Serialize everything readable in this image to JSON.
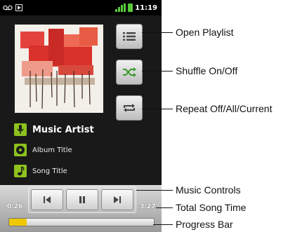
{
  "status_bar": {
    "left_icons": [
      "voicemail-icon",
      "media-play-icon"
    ],
    "time": "11:19"
  },
  "player": {
    "artist": "Music Artist",
    "album": "Album Title",
    "song": "Song Title",
    "elapsed": "0:26",
    "total": "3:27",
    "progress_fraction": 0.12
  },
  "side_buttons": [
    {
      "name": "open-playlist-button",
      "icon": "playlist-icon"
    },
    {
      "name": "shuffle-button",
      "icon": "shuffle-icon"
    },
    {
      "name": "repeat-button",
      "icon": "repeat-icon"
    }
  ],
  "controls": [
    {
      "name": "previous-button",
      "icon": "previous-icon"
    },
    {
      "name": "pause-button",
      "icon": "pause-icon"
    },
    {
      "name": "next-button",
      "icon": "next-icon"
    }
  ],
  "callouts": {
    "open_playlist": "Open Playlist",
    "shuffle": "Shuffle On/Off",
    "repeat": "Repeat Off/All/Current",
    "music_controls": "Music Controls",
    "total_song_time": "Total Song Time",
    "progress_bar": "Progress Bar"
  },
  "colors": {
    "accent_green": "#8ec21f",
    "progress_yellow": "#f0c800",
    "screen_bg": "#191919"
  }
}
